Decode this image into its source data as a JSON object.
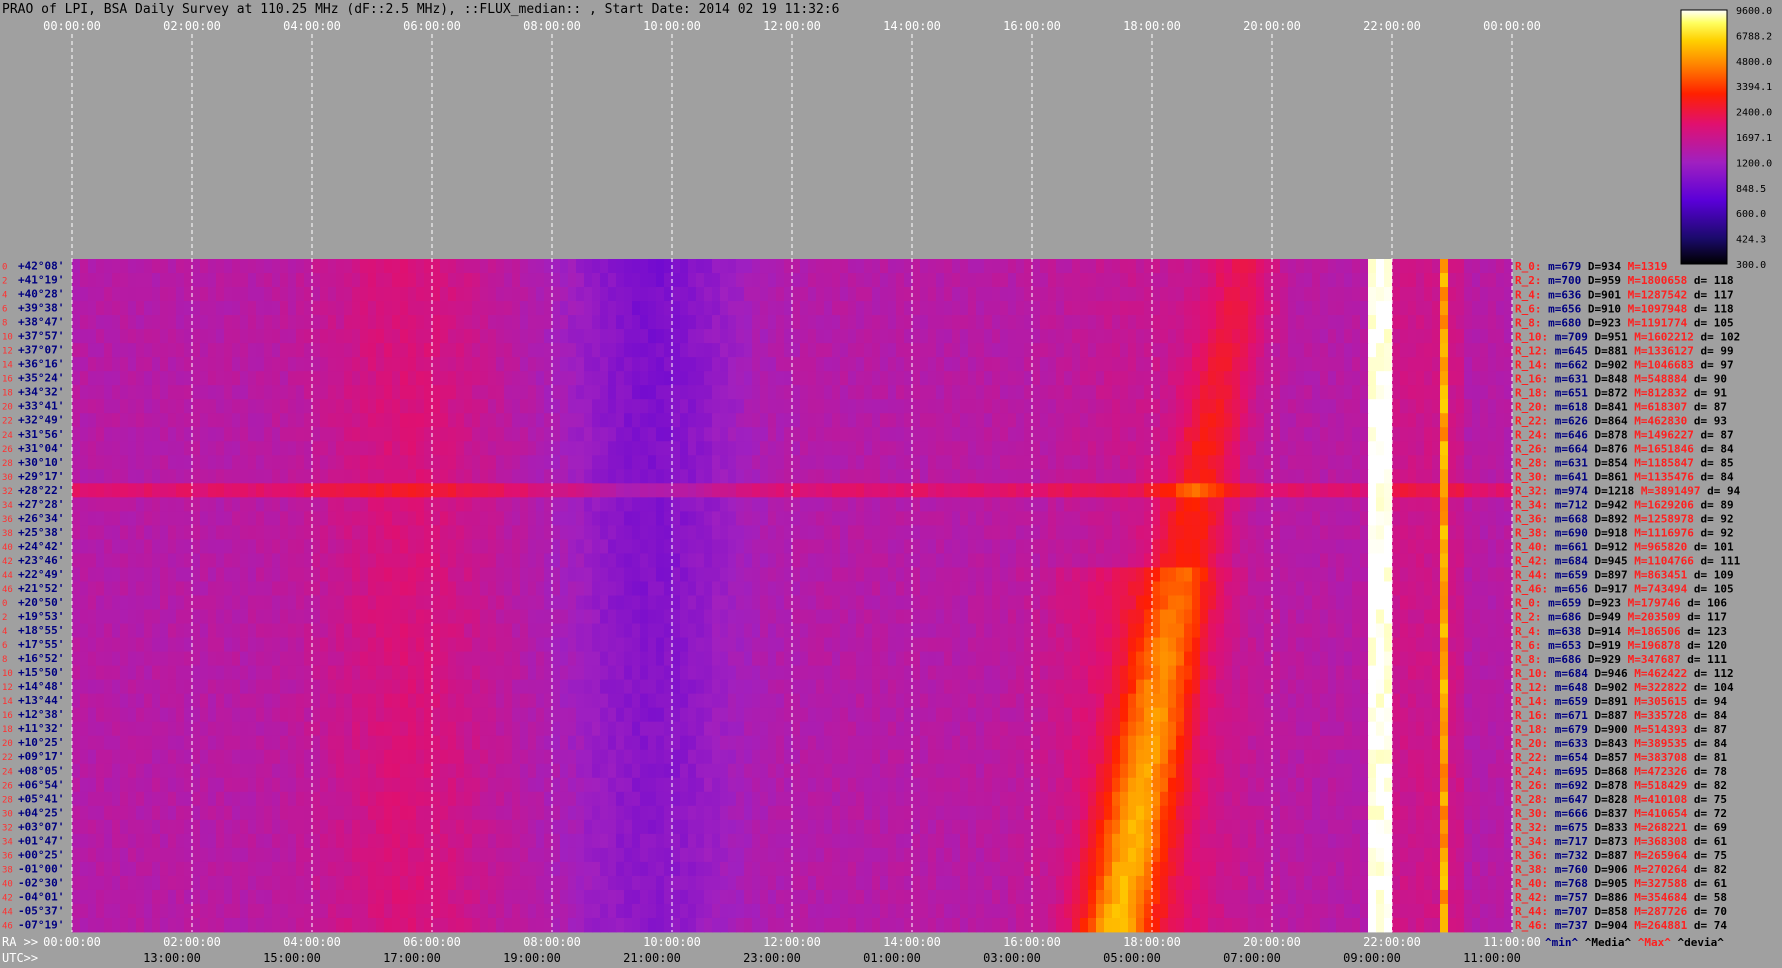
{
  "title": "PRAO of LPI, BSA Daily Survey at 110.25 MHz (dF::2.5 MHz), ::FLUX_median:: , Start Date: 2014 02 19 11:32:6",
  "colors": {
    "background": "#a0a0a0",
    "grid": "#ffffff",
    "ra_text": "#ffffff"
  },
  "chart_data": {
    "type": "heatmap",
    "colormap": "black-blue-purple-red-orange-yellow-white",
    "colorbar": {
      "ticks": [
        "9600.0",
        "6788.2",
        "4800.0",
        "3394.1",
        "2400.0",
        "1697.1",
        "1200.0",
        "848.5",
        "600.0",
        "424.3",
        "300.0"
      ],
      "scale": "log",
      "range": [
        300,
        9600
      ]
    },
    "top_axis_ticks": [
      "00:00:00",
      "02:00:00",
      "04:00:00",
      "06:00:00",
      "08:00:00",
      "10:00:00",
      "12:00:00",
      "14:00:00",
      "16:00:00",
      "18:00:00",
      "20:00:00",
      "22:00:00",
      "00:00:00"
    ],
    "ra_axis_ticks": [
      "00:00:00",
      "02:00:00",
      "04:00:00",
      "06:00:00",
      "08:00:00",
      "10:00:00",
      "12:00:00",
      "14:00:00",
      "16:00:00",
      "18:00:00",
      "20:00:00",
      "22:00:00",
      "11:00:00"
    ],
    "utc_axis_ticks": [
      "13:00:00",
      "15:00:00",
      "17:00:00",
      "19:00:00",
      "21:00:00",
      "23:00:00",
      "01:00:00",
      "03:00:00",
      "05:00:00",
      "07:00:00",
      "09:00:00",
      "11:00:00"
    ],
    "ra_prefix": "RA >>",
    "utc_prefix": "UTC>>",
    "row_index_labels": [
      "0",
      "2",
      "4",
      "6",
      "8",
      "10",
      "12",
      "14",
      "16",
      "18",
      "20",
      "22",
      "24",
      "26",
      "28",
      "30",
      "32",
      "34",
      "36",
      "38",
      "40",
      "42",
      "44",
      "46",
      "0",
      "2",
      "4",
      "6",
      "8",
      "10",
      "12",
      "14",
      "16",
      "18",
      "20",
      "22",
      "24",
      "26",
      "28",
      "30",
      "32",
      "34",
      "36",
      "38",
      "40",
      "42",
      "44",
      "46"
    ],
    "declinations": [
      "+42°08'",
      "+41°19'",
      "+40°28'",
      "+39°38'",
      "+38°47'",
      "+37°57'",
      "+37°07'",
      "+36°16'",
      "+35°24'",
      "+34°32'",
      "+33°41'",
      "+32°49'",
      "+31°56'",
      "+31°04'",
      "+30°10'",
      "+29°17'",
      "+28°22'",
      "+27°28'",
      "+26°34'",
      "+25°38'",
      "+24°42'",
      "+23°46'",
      "+22°49'",
      "+21°52'",
      "+20°50'",
      "+19°53'",
      "+18°55'",
      "+17°55'",
      "+16°52'",
      "+15°50'",
      "+14°48'",
      "+13°44'",
      "+12°38'",
      "+11°32'",
      "+10°25'",
      "+09°17'",
      "+08°05'",
      "+06°54'",
      "+05°41'",
      "+04°25'",
      "+03°07'",
      "+01°47'",
      "+00°25'",
      "-01°00'",
      "-02°30'",
      "-04°01'",
      "-05°37'",
      "-07°19'"
    ],
    "row_stats": [
      {
        "label": "R_0:",
        "m": "m=679",
        "D": "D=934",
        "M": "M=1319",
        "d": ""
      },
      {
        "label": "R_2:",
        "m": "m=700",
        "D": "D=959",
        "M": "M=1800658",
        "d": "d= 118"
      },
      {
        "label": "R_4:",
        "m": "m=636",
        "D": "D=901",
        "M": "M=1287542",
        "d": "d= 117"
      },
      {
        "label": "R_6:",
        "m": "m=656",
        "D": "D=910",
        "M": "M=1097948",
        "d": "d= 118"
      },
      {
        "label": "R_8:",
        "m": "m=680",
        "D": "D=923",
        "M": "M=1191774",
        "d": "d= 105"
      },
      {
        "label": "R_10:",
        "m": "m=709",
        "D": "D=951",
        "M": "M=1602212",
        "d": "d= 102"
      },
      {
        "label": "R_12:",
        "m": "m=645",
        "D": "D=881",
        "M": "M=1336127",
        "d": "d= 99"
      },
      {
        "label": "R_14:",
        "m": "m=662",
        "D": "D=902",
        "M": "M=1046683",
        "d": "d= 97"
      },
      {
        "label": "R_16:",
        "m": "m=631",
        "D": "D=848",
        "M": "M=548884",
        "d": "d= 90"
      },
      {
        "label": "R_18:",
        "m": "m=651",
        "D": "D=872",
        "M": "M=812832",
        "d": "d= 91"
      },
      {
        "label": "R_20:",
        "m": "m=618",
        "D": "D=841",
        "M": "M=618307",
        "d": "d= 87"
      },
      {
        "label": "R_22:",
        "m": "m=626",
        "D": "D=864",
        "M": "M=462830",
        "d": "d= 93"
      },
      {
        "label": "R_24:",
        "m": "m=646",
        "D": "D=878",
        "M": "M=1496227",
        "d": "d= 87"
      },
      {
        "label": "R_26:",
        "m": "m=664",
        "D": "D=876",
        "M": "M=1651846",
        "d": "d= 84"
      },
      {
        "label": "R_28:",
        "m": "m=631",
        "D": "D=854",
        "M": "M=1185847",
        "d": "d= 85"
      },
      {
        "label": "R_30:",
        "m": "m=641",
        "D": "D=861",
        "M": "M=1135476",
        "d": "d= 84"
      },
      {
        "label": "R_32:",
        "m": "m=974",
        "D": "D=1218",
        "M": "M=3891497",
        "d": "d= 94"
      },
      {
        "label": "R_34:",
        "m": "m=712",
        "D": "D=942",
        "M": "M=1629206",
        "d": "d= 89"
      },
      {
        "label": "R_36:",
        "m": "m=668",
        "D": "D=892",
        "M": "M=1258978",
        "d": "d= 92"
      },
      {
        "label": "R_38:",
        "m": "m=690",
        "D": "D=918",
        "M": "M=1116976",
        "d": "d= 92"
      },
      {
        "label": "R_40:",
        "m": "m=661",
        "D": "D=912",
        "M": "M=965820",
        "d": "d= 101"
      },
      {
        "label": "R_42:",
        "m": "m=684",
        "D": "D=945",
        "M": "M=1104766",
        "d": "d= 111"
      },
      {
        "label": "R_44:",
        "m": "m=659",
        "D": "D=897",
        "M": "M=863451",
        "d": "d= 109"
      },
      {
        "label": "R_46:",
        "m": "m=656",
        "D": "D=917",
        "M": "M=743494",
        "d": "d= 105"
      },
      {
        "label": "R_0:",
        "m": "m=659",
        "D": "D=923",
        "M": "M=179746",
        "d": "d= 106"
      },
      {
        "label": "R_2:",
        "m": "m=686",
        "D": "D=949",
        "M": "M=203509",
        "d": "d= 117"
      },
      {
        "label": "R_4:",
        "m": "m=638",
        "D": "D=914",
        "M": "M=186506",
        "d": "d= 123"
      },
      {
        "label": "R_6:",
        "m": "m=653",
        "D": "D=919",
        "M": "M=196878",
        "d": "d= 120"
      },
      {
        "label": "R_8:",
        "m": "m=686",
        "D": "D=929",
        "M": "M=347687",
        "d": "d= 111"
      },
      {
        "label": "R_10:",
        "m": "m=684",
        "D": "D=946",
        "M": "M=462422",
        "d": "d= 112"
      },
      {
        "label": "R_12:",
        "m": "m=648",
        "D": "D=902",
        "M": "M=322822",
        "d": "d= 104"
      },
      {
        "label": "R_14:",
        "m": "m=659",
        "D": "D=891",
        "M": "M=305615",
        "d": "d= 94"
      },
      {
        "label": "R_16:",
        "m": "m=671",
        "D": "D=887",
        "M": "M=335728",
        "d": "d= 84"
      },
      {
        "label": "R_18:",
        "m": "m=679",
        "D": "D=900",
        "M": "M=514393",
        "d": "d= 87"
      },
      {
        "label": "R_20:",
        "m": "m=633",
        "D": "D=843",
        "M": "M=389535",
        "d": "d= 84"
      },
      {
        "label": "R_22:",
        "m": "m=654",
        "D": "D=857",
        "M": "M=383708",
        "d": "d= 81"
      },
      {
        "label": "R_24:",
        "m": "m=695",
        "D": "D=868",
        "M": "M=472326",
        "d": "d= 78"
      },
      {
        "label": "R_26:",
        "m": "m=692",
        "D": "D=878",
        "M": "M=518429",
        "d": "d= 82"
      },
      {
        "label": "R_28:",
        "m": "m=647",
        "D": "D=828",
        "M": "M=410108",
        "d": "d= 75"
      },
      {
        "label": "R_30:",
        "m": "m=666",
        "D": "D=837",
        "M": "M=410654",
        "d": "d= 72"
      },
      {
        "label": "R_32:",
        "m": "m=675",
        "D": "D=833",
        "M": "M=268221",
        "d": "d= 69"
      },
      {
        "label": "R_34:",
        "m": "m=717",
        "D": "D=873",
        "M": "M=368308",
        "d": "d= 61"
      },
      {
        "label": "R_36:",
        "m": "m=732",
        "D": "D=887",
        "M": "M=265964",
        "d": "d= 75"
      },
      {
        "label": "R_38:",
        "m": "m=760",
        "D": "D=906",
        "M": "M=270264",
        "d": "d= 82"
      },
      {
        "label": "R_40:",
        "m": "m=768",
        "D": "D=905",
        "M": "M=327588",
        "d": "d= 61"
      },
      {
        "label": "R_42:",
        "m": "m=757",
        "D": "D=886",
        "M": "M=354684",
        "d": "d= 58"
      },
      {
        "label": "R_44:",
        "m": "m=707",
        "D": "D=858",
        "M": "M=287726",
        "d": "d= 70"
      },
      {
        "label": "R_46:",
        "m": "m=737",
        "D": "D=904",
        "M": "M=264881",
        "d": "d= 74"
      }
    ],
    "stats_footer": [
      "^min^",
      "^Media^",
      "^Max^",
      "^devia^"
    ]
  }
}
